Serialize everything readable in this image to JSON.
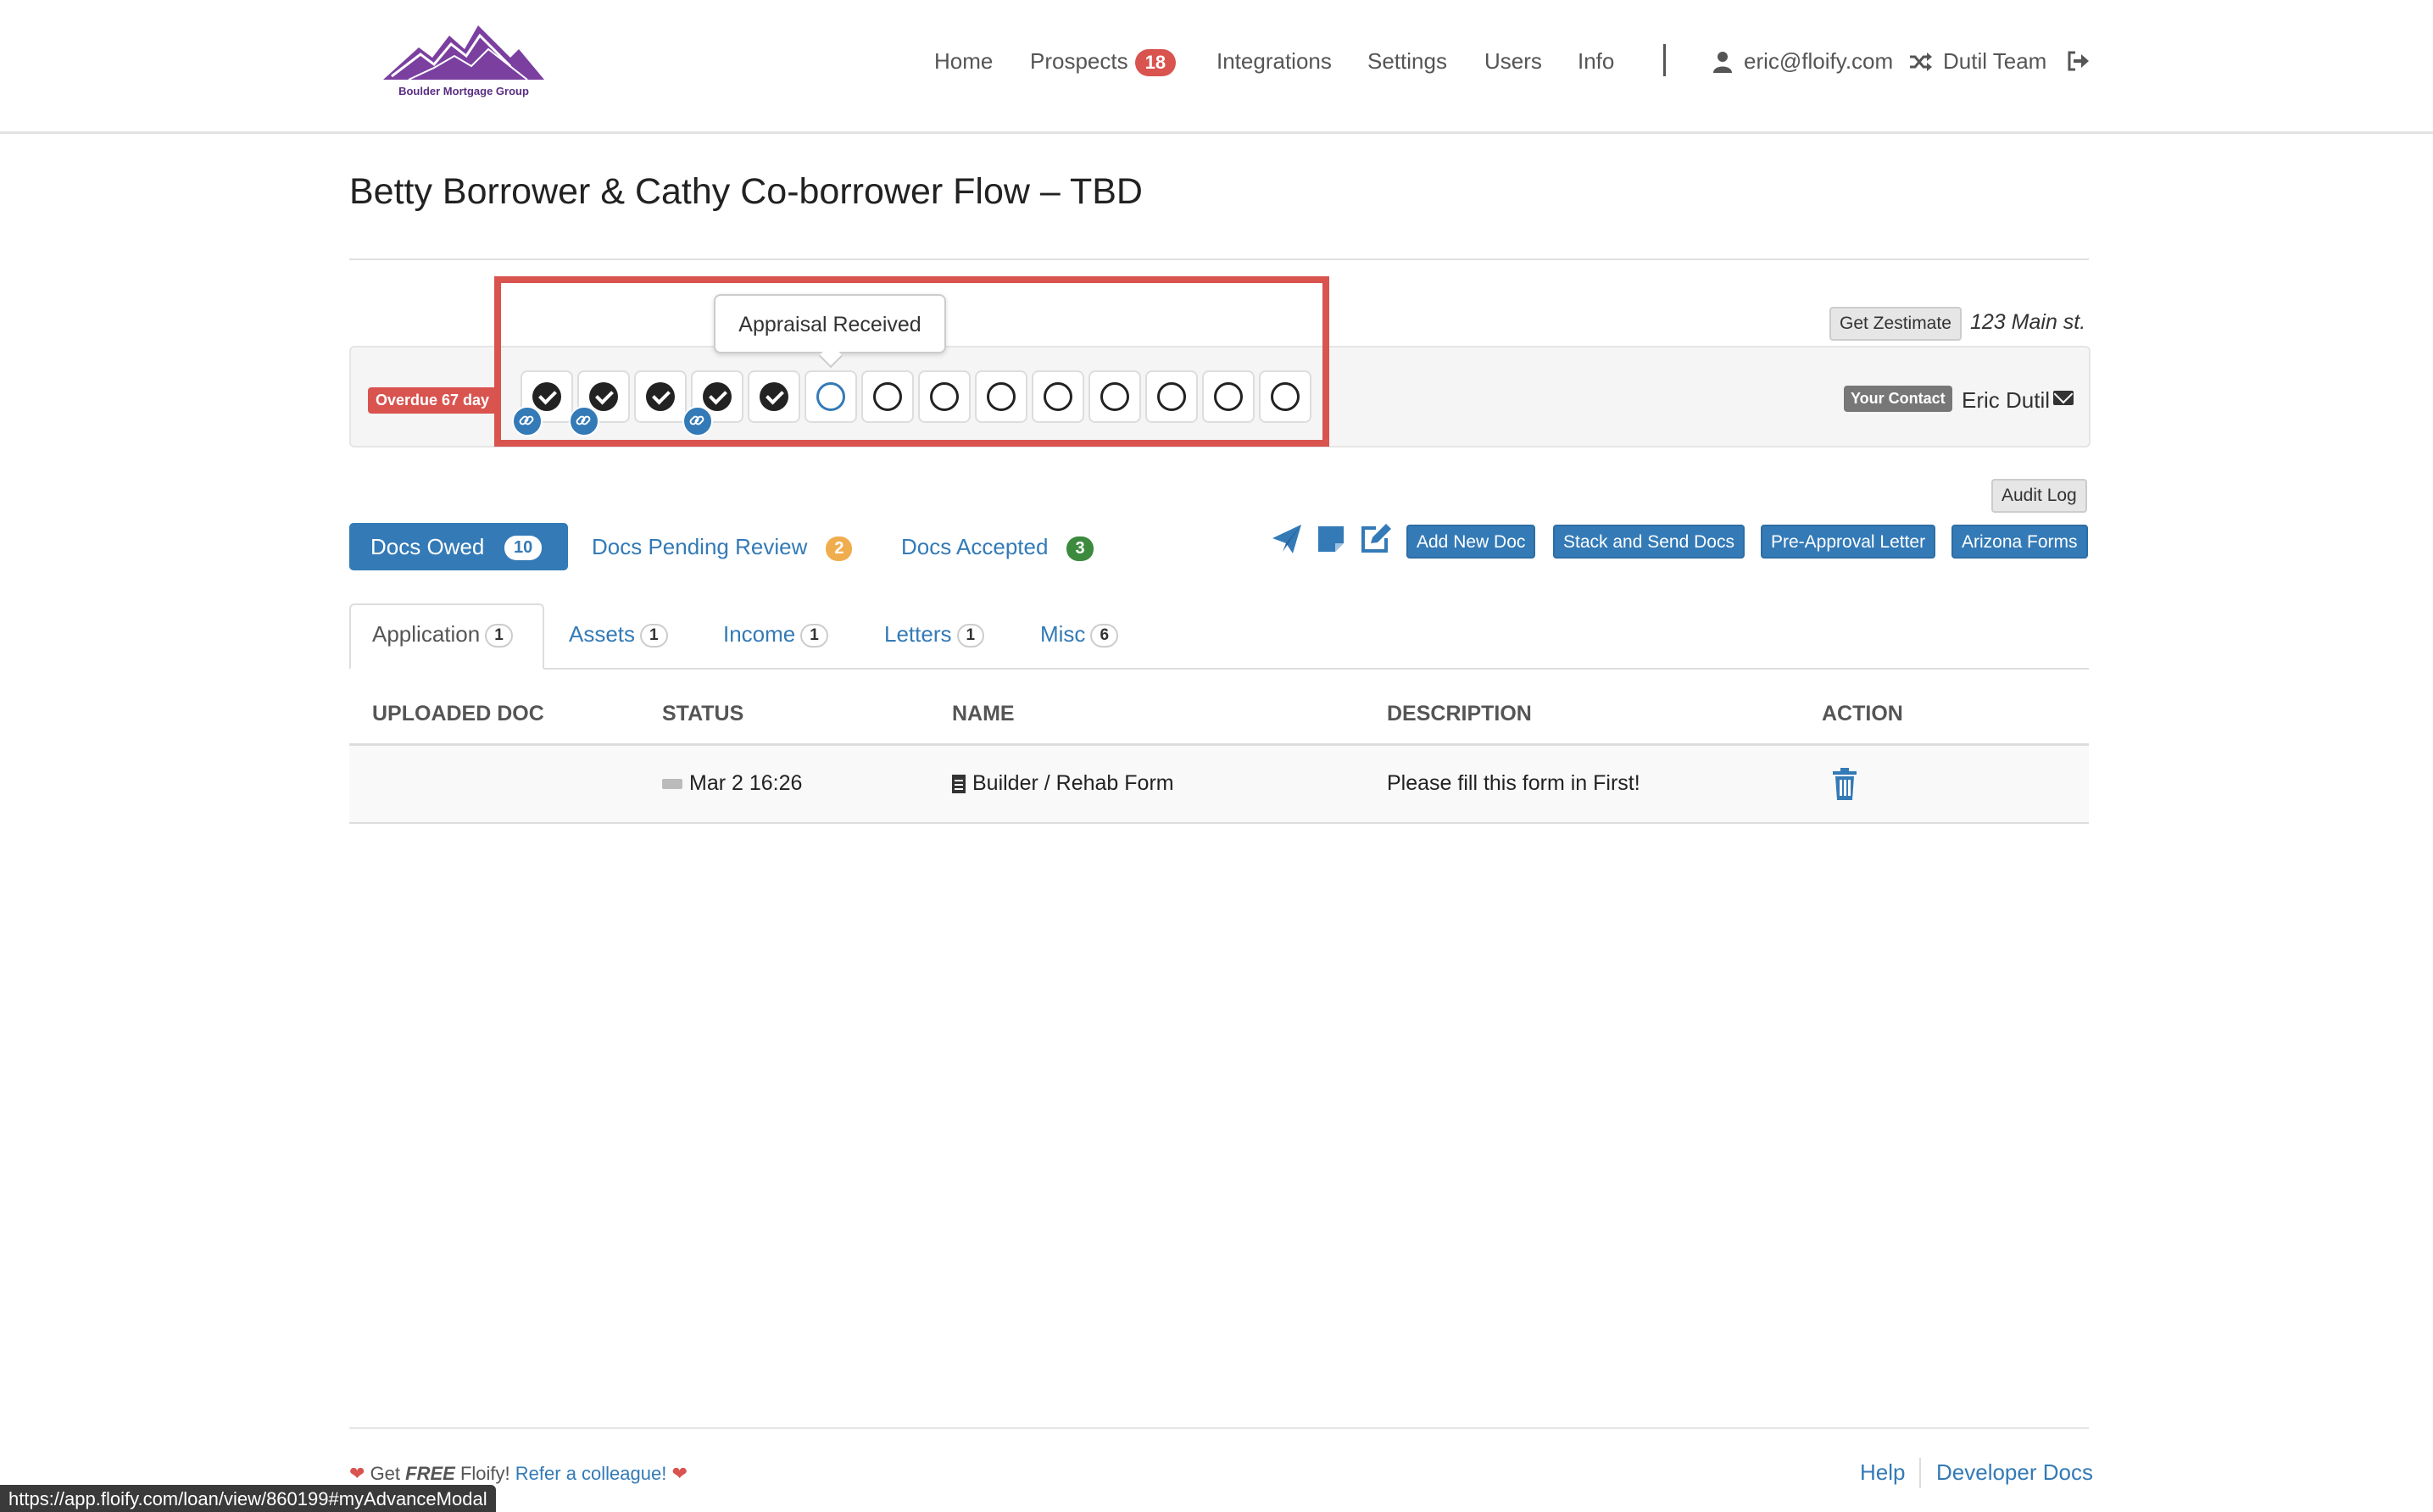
{
  "brand": {
    "name": "Boulder Mortgage Group",
    "colors": {
      "logo": "#7b3fa0",
      "primary": "#337ab7",
      "danger": "#d9534f",
      "warning": "#f0ad4e",
      "success": "#3c8a3e"
    }
  },
  "nav": {
    "home": "Home",
    "prospects": "Prospects",
    "prospects_count": "18",
    "integrations": "Integrations",
    "settings": "Settings",
    "users": "Users",
    "info": "Info",
    "user_email": "eric@floify.com",
    "team": "Dutil Team",
    "icons": [
      "user-icon",
      "shuffle-icon",
      "logout-icon"
    ]
  },
  "loan": {
    "title": "Betty Borrower & Cathy Co-borrower Flow – TBD"
  },
  "progress": {
    "overdue": "Overdue 67 day",
    "tooltip": "Appraisal Received",
    "steps": [
      "done",
      "done",
      "done",
      "done",
      "done",
      "current",
      "open",
      "open",
      "open",
      "open",
      "open",
      "open",
      "open",
      "open"
    ],
    "linked_steps": [
      0,
      1,
      3
    ]
  },
  "property": {
    "zestimate_button": "Get Zestimate",
    "address": "123 Main st."
  },
  "contact": {
    "label": "Your Contact",
    "name": "Eric Dutil"
  },
  "audit_log": "Audit Log",
  "doc_tabs": {
    "owed": {
      "label": "Docs Owed",
      "count": "10"
    },
    "pending": {
      "label": "Docs Pending Review",
      "count": "2"
    },
    "accepted": {
      "label": "Docs Accepted",
      "count": "3"
    }
  },
  "actions": {
    "icons": [
      "send-icon",
      "note-icon",
      "edit-icon"
    ],
    "add_new_doc": "Add New Doc",
    "stack_send": "Stack and Send Docs",
    "preapproval": "Pre-Approval Letter",
    "arizona": "Arizona Forms"
  },
  "category_tabs": [
    {
      "label": "Application",
      "count": "1"
    },
    {
      "label": "Assets",
      "count": "1"
    },
    {
      "label": "Income",
      "count": "1"
    },
    {
      "label": "Letters",
      "count": "1"
    },
    {
      "label": "Misc",
      "count": "6"
    }
  ],
  "table": {
    "headers": [
      "Uploaded Doc",
      "Status",
      "Name",
      "Description",
      "Action"
    ],
    "rows": [
      {
        "uploaded": "",
        "status": "Mar 2 16:26",
        "name": "Builder / Rehab Form",
        "description": "Please fill this form in First!",
        "action_icon": "trash-icon"
      }
    ]
  },
  "footer": {
    "get": "Get",
    "free": "FREE",
    "floify": "Floify!",
    "refer": "Refer a colleague!",
    "help": "Help",
    "developer_docs": "Developer Docs"
  },
  "status_url": "https://app.floify.com/loan/view/860199#myAdvanceModal"
}
